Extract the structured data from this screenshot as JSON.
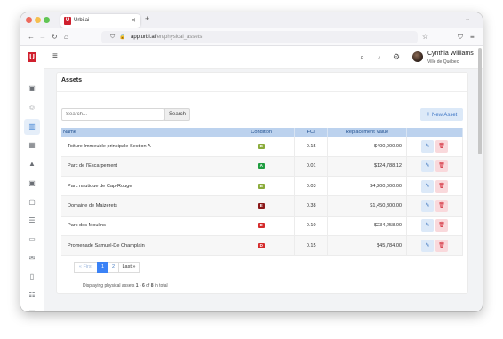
{
  "browser": {
    "tab_title": "Urbi.ai",
    "tab_favicon": "U",
    "url_host": "app.urbi.ai",
    "url_path": "/en/physical_assets",
    "dot_colors": [
      "#ed6a5e",
      "#f5bf4f",
      "#61c554"
    ]
  },
  "app": {
    "logo_letter": "U",
    "brand_color": "#d0202e",
    "user": {
      "name": "Cynthia Williams",
      "city": "Ville de Québec"
    },
    "sidebar_icons": [
      "calendar-icon",
      "recycle-icon",
      "building-icon",
      "map-icon",
      "tree-icon",
      "calendar-icon",
      "chat-icon",
      "list-icon",
      "folder-icon",
      "mail-icon",
      "book-icon",
      "settings-sliders-icon",
      "briefcase-icon"
    ],
    "active_sidebar_index": 2
  },
  "assets": {
    "title": "Assets",
    "search_placeholder": "Search...",
    "search_button": "Search",
    "new_asset_label": "New Asset",
    "columns": [
      "Name",
      "Condition",
      "FCI",
      "Replacement Value"
    ],
    "rows": [
      {
        "name": "Toiture Immeuble principale Section A",
        "condition": "B",
        "condition_color": "#8aab3a",
        "fci": "0.15",
        "value": "$400,000.00"
      },
      {
        "name": "Parc de l'Escarpement",
        "condition": "A",
        "condition_color": "#1f9d3f",
        "fci": "0.01",
        "value": "$124,788.12"
      },
      {
        "name": "Parc nautique de Cap-Rouge",
        "condition": "B",
        "condition_color": "#8aab3a",
        "fci": "0.03",
        "value": "$4,200,000.00"
      },
      {
        "name": "Domaine de Maizerets",
        "condition": "E",
        "condition_color": "#8b1a1a",
        "fci": "0.38",
        "value": "$1,450,800.00"
      },
      {
        "name": "Parc des Moulins",
        "condition": "D",
        "condition_color": "#d42b2b",
        "fci": "0.10",
        "value": "$234,258.00"
      },
      {
        "name": "Promenade Samuel-De Champlain",
        "condition": "D",
        "condition_color": "#d42b2b",
        "fci": "0.15",
        "value": "$45,784.00"
      }
    ],
    "pagination": {
      "first": "« First",
      "pages": [
        "1",
        "2"
      ],
      "current": "1",
      "last": "Last »"
    },
    "display_prefix": "Displaying physical assets ",
    "display_range": "1 - 6",
    "display_of": " of ",
    "display_total": "8",
    "display_suffix": " in total"
  }
}
